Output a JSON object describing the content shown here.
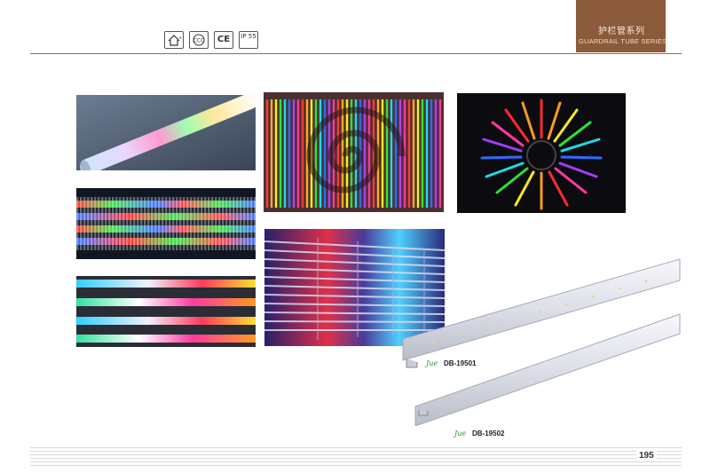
{
  "header": {
    "cert_icons": [
      {
        "name": "house-certification-icon",
        "glyph": "⌂"
      },
      {
        "name": "ccc-certification-icon",
        "glyph": "Ⓒ"
      },
      {
        "name": "ce-certification-icon",
        "glyph": "CE"
      },
      {
        "name": "ip55-rating-icon",
        "glyph": "IP 55"
      }
    ],
    "title_cn": "护栏管系列",
    "title_en": "GUARDRAIL TUBE SERIES"
  },
  "products": [
    {
      "model": "DB-19501",
      "logo": "Jue"
    },
    {
      "model": "DB-19502",
      "logo": "Jue"
    }
  ],
  "page_number": "195",
  "colors": {
    "brand": "#8a5a3b",
    "rule": "#9b6a47"
  }
}
